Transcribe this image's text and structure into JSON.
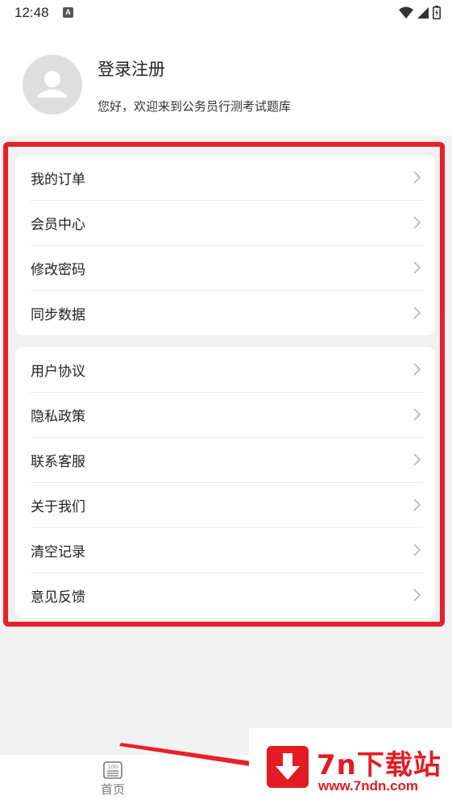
{
  "status_bar": {
    "time": "12:48",
    "notification_icon": "A"
  },
  "profile": {
    "login_title": "登录注册",
    "welcome": "您好，欢迎来到公务员行测考试题库"
  },
  "menu": {
    "group1": [
      {
        "label": "我的订单",
        "icon": "chevron-right-icon"
      },
      {
        "label": "会员中心",
        "icon": "chevron-right-icon"
      },
      {
        "label": "修改密码",
        "icon": "chevron-right-icon"
      },
      {
        "label": "同步数据",
        "icon": "chevron-right-icon"
      }
    ],
    "group2": [
      {
        "label": "用户协议",
        "icon": "chevron-right-icon"
      },
      {
        "label": "隐私政策",
        "icon": "chevron-right-icon"
      },
      {
        "label": "联系客服",
        "icon": "chevron-right-icon"
      },
      {
        "label": "关于我们",
        "icon": "chevron-right-icon"
      },
      {
        "label": "清空记录",
        "icon": "chevron-right-icon"
      },
      {
        "label": "意见反馈",
        "icon": "chevron-right-icon"
      }
    ]
  },
  "tab_bar": {
    "home_label": "首页",
    "home_icon_text": "100"
  },
  "watermark": {
    "title": "7n下载站",
    "url": "www.7ndn.com"
  },
  "colors": {
    "highlight": "#e8202a",
    "watermark": "#e31b23",
    "background": "#f2f2f2"
  }
}
